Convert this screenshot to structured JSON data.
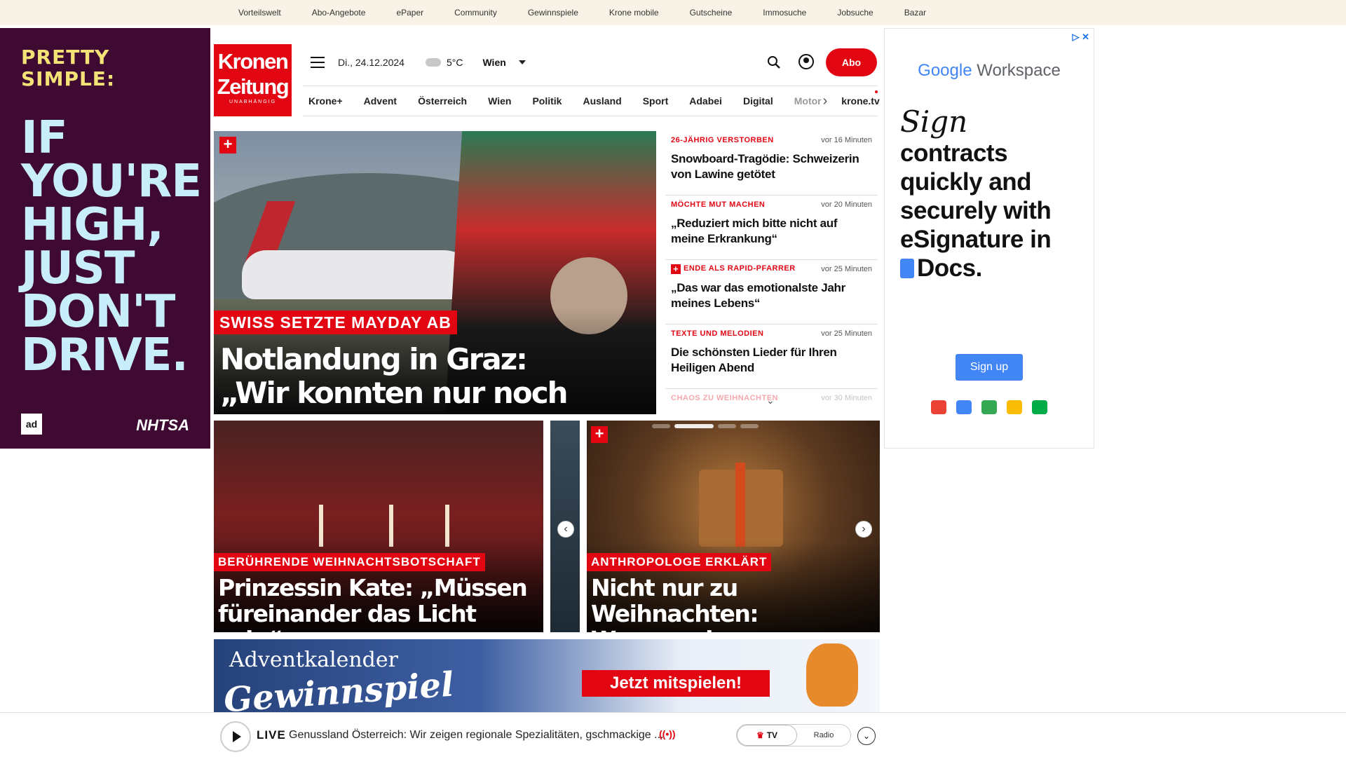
{
  "topbar": {
    "links": [
      "Vorteilswelt",
      "Abo-Angebote",
      "ePaper",
      "Community",
      "Gewinnspiele",
      "Krone mobile",
      "Gutscheine",
      "Immosuche",
      "Jobsuche",
      "Bazar"
    ]
  },
  "ad_left": {
    "line1": "PRETTY",
    "line2": "SIMPLE:",
    "big1": "IF",
    "big2": "YOU'RE",
    "big3": "HIGH,",
    "big4": "JUST",
    "big5": "DON'T",
    "big6": "DRIVE.",
    "logo1": "ad",
    "logo2": "NHTSA"
  },
  "logo": {
    "line1": "Kronen",
    "line2": "Zeitung",
    "line3": "UNABHÄNGIG"
  },
  "header": {
    "date": "Di., 24.12.2024",
    "temperature": "5°C",
    "city": "Wien",
    "abo_label": "Abo"
  },
  "nav": {
    "items": [
      "Krone+",
      "Advent",
      "Österreich",
      "Wien",
      "Politik",
      "Ausland",
      "Sport",
      "Adabei",
      "Digital"
    ],
    "truncated_item": "Motor",
    "tv_link": "krone.tv"
  },
  "hero": {
    "kicker": "SWISS SETZTE MAYDAY AB",
    "headline_line1": "Notlandung in Graz:",
    "headline_line2": "„Wir konnten nur noch beten“"
  },
  "ticker": {
    "items": [
      {
        "category": "26-JÄHRIG VERSTORBEN",
        "time": "vor 16 Minuten",
        "title": "Snowboard-Tragödie: Schweizerin von Lawine getötet",
        "plus": false
      },
      {
        "category": "MÖCHTE MUT MACHEN",
        "time": "vor 20 Minuten",
        "title": "„Reduziert mich bitte nicht auf meine Erkrankung“",
        "plus": false
      },
      {
        "category": "ENDE ALS RAPID-PFARRER",
        "time": "vor 25 Minuten",
        "title": "„Das war das emotionalste Jahr meines Lebens“",
        "plus": true
      },
      {
        "category": "TEXTE UND MELODIEN",
        "time": "vor 25 Minuten",
        "title": "Die schönsten Lieder für Ihren Heiligen Abend",
        "plus": false
      },
      {
        "category": "CHAOS ZU WEIHNACHTEN",
        "time": "vor 30 Minuten",
        "title": "",
        "plus": false
      }
    ]
  },
  "cards": {
    "card1": {
      "kicker": "BERÜHRENDE WEIHNACHTSBOTSCHAFT",
      "line1": "Prinzessin Kate: „Müssen",
      "line2": "füreinander das Licht sein“"
    },
    "card3": {
      "kicker": "ANTHROPOLOGE ERKLÄRT",
      "line1": "Nicht nur zu Weihnachten:",
      "line2": "Warum wir uns beschenken"
    }
  },
  "promo": {
    "title": "Adventkalender",
    "subtitle": "Gewinnspiel",
    "cta": "Jetzt mitspielen!"
  },
  "ad_right": {
    "brand_google": "Google",
    "brand_product": "Workspace",
    "sign": "Sign",
    "copy1": "contracts",
    "copy2": "quickly and",
    "copy3": "securely with",
    "copy4": "eSignature in",
    "copy5": "Docs.",
    "signup": "Sign up"
  },
  "player": {
    "live_label": "LIVE",
    "live_text": "Genussland Österreich: Wir zeigen regionale Spezialitäten, gschmackige ...",
    "tv_label": "TV",
    "radio_label": "Radio"
  },
  "colors": {
    "brand_red": "#e20613",
    "topbar_bg": "#f8f3e6",
    "ad_left_bg": "#3f0a32",
    "google_blue": "#4285f4"
  }
}
